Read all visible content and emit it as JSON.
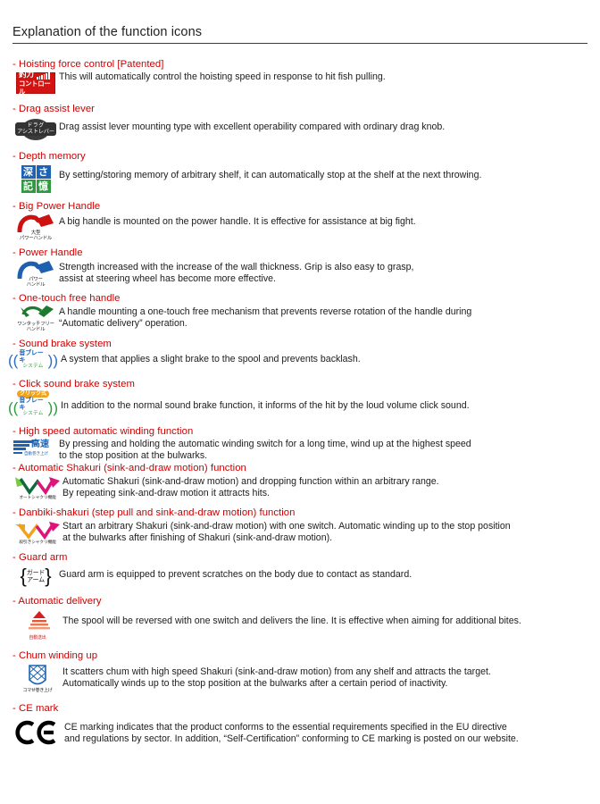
{
  "header": {
    "title": "Explanation of the function icons"
  },
  "entries": [
    {
      "title": "- Hoisting force control [Patented]",
      "icon": "hoisting-force-control-icon",
      "icon_text": {
        "line1": "釣力",
        "line2": "コントロール"
      },
      "desc_line1": "This will automatically control the hoisting speed in response to hit fish pulling.",
      "desc_line2": ""
    },
    {
      "title": "- Drag assist lever",
      "icon": "drag-assist-lever-icon",
      "icon_text": {
        "line1": "ドラグ",
        "line2": "アシストレバー"
      },
      "desc_line1": "Drag assist lever mounting type with excellent operability compared with ordinary drag knob.",
      "desc_line2": ""
    },
    {
      "title": "- Depth memory",
      "icon": "depth-memory-icon",
      "icon_text": {
        "t1": "深",
        "t2": "さ",
        "t3": "記",
        "t4": "憶"
      },
      "desc_line1": "By setting/storing memory of arbitrary shelf, it can automatically stop at the shelf at the next throwing.",
      "desc_line2": ""
    },
    {
      "title": "- Big Power Handle",
      "icon": "big-power-handle-icon",
      "icon_text": {
        "line1": "大型",
        "line2": "パワーハンドル"
      },
      "desc_line1": "A big handle is mounted on the power handle. It is effective for assistance at big fight.",
      "desc_line2": ""
    },
    {
      "title": "- Power Handle",
      "icon": "power-handle-icon",
      "icon_text": {
        "line1": "パワー",
        "line2": "ハンドル"
      },
      "desc_line1": "Strength increased with the increase of the wall thickness. Grip is also easy to grasp,",
      "desc_line2": "assist at steering wheel has become more effective."
    },
    {
      "title": "- One-touch free handle",
      "icon": "one-touch-free-handle-icon",
      "icon_text": {
        "line1": "ワンタッチフリー",
        "line2": "ハンドル"
      },
      "desc_line1": "A handle mounting a one-touch free mechanism that prevents reverse rotation of the handle during",
      "desc_line2": "“Automatic delivery” operation."
    },
    {
      "title": "- Sound brake system",
      "icon": "sound-brake-system-icon",
      "icon_text": {
        "line1": "音ブレーキ",
        "line2": "システム"
      },
      "desc_line1": "A system that applies a slight brake to the spool and prevents backlash.",
      "desc_line2": ""
    },
    {
      "title": "- Click sound brake system",
      "icon": "click-sound-brake-system-icon",
      "icon_text": {
        "badge": "クリック式",
        "line1": "音ブレーキ",
        "line2": "システム"
      },
      "desc_line1": "In addition to the normal sound brake function, it informs of the hit by the loud volume click sound.",
      "desc_line2": ""
    },
    {
      "title": "- High speed automatic winding function",
      "icon": "high-speed-winding-icon",
      "icon_text": {
        "line1": "高速",
        "line2": "自動巻き上げ"
      },
      "desc_line1": "By pressing and holding the automatic winding switch for a long time, wind up at the highest speed",
      "desc_line2": "to the stop position at the bulwarks."
    },
    {
      "title": "- Automatic Shakuri (sink-and-draw motion) function",
      "icon": "automatic-shakuri-icon",
      "icon_text": {
        "line1": "オートシャクリ機能"
      },
      "desc_line1": "Automatic Shakuri (sink-and-draw motion) and dropping function within an arbitrary range.",
      "desc_line2": "By repeating sink-and-draw motion it attracts hits."
    },
    {
      "title": "- Danbiki-shakuri (step pull and sink-and-draw motion) function",
      "icon": "danbiki-shakuri-icon",
      "icon_text": {
        "line1": "段引きシャクリ機能"
      },
      "desc_line1": "Start an arbitrary Shakuri (sink-and-draw motion) with one switch. Automatic winding up to the stop position",
      "desc_line2": "at the bulwarks after finishing of Shakuri (sink-and-draw motion)."
    },
    {
      "title": "- Guard arm",
      "icon": "guard-arm-icon",
      "icon_text": {
        "line1": "ガード",
        "line2": "アーム"
      },
      "desc_line1": "Guard arm is equipped to prevent scratches on the body due to contact as standard.",
      "desc_line2": ""
    },
    {
      "title": "- Automatic delivery",
      "icon": "automatic-delivery-icon",
      "icon_text": {
        "line1": "自動送出"
      },
      "desc_line1": "The spool will be reversed with one switch and delivers the line. It is effective when aiming for additional bites.",
      "desc_line2": ""
    },
    {
      "title": "- Chum winding up",
      "icon": "chum-winding-up-icon",
      "icon_text": {
        "line1": "コマせ巻き上げ"
      },
      "desc_line1": "It scatters chum with high speed Shakuri (sink-and-draw motion) from any shelf and attracts the target.",
      "desc_line2": "Automatically winds up to the stop position at the bulwarks after a certain period of inactivity."
    },
    {
      "title": "- CE mark",
      "icon": "ce-mark-icon",
      "icon_text": {
        "line1": "CE"
      },
      "desc_line1": "CE marking indicates that the product conforms to the essential requirements specified in the EU directive",
      "desc_line2": "and regulations by sector. In addition, “Self-Certification” conforming to CE marking is posted on our website."
    }
  ],
  "colors": {
    "title_red": "#cc0000",
    "body_text": "#1c1c1c",
    "rule": "#3a3a3a",
    "icon_red": "#d31212",
    "icon_blue": "#1d63b5",
    "icon_green": "#2e9b3f",
    "icon_orange": "#f0a21a"
  }
}
